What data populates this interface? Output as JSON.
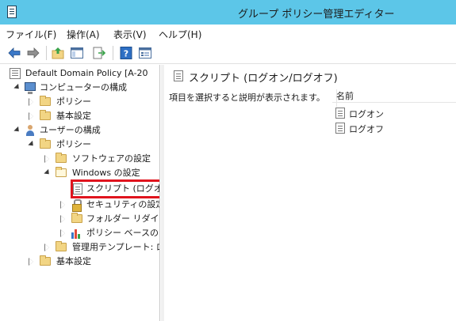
{
  "window": {
    "title": "グループ ポリシー管理エディター"
  },
  "menu": [
    {
      "label": "ファイル(F)"
    },
    {
      "label": "操作(A)"
    },
    {
      "label": "表示(V)"
    },
    {
      "label": "ヘルプ(H)"
    }
  ],
  "toolbar": {
    "buttons": [
      {
        "icon": "back-arrow-icon"
      },
      {
        "icon": "forward-arrow-icon"
      },
      {
        "icon": "up-folder-icon"
      },
      {
        "icon": "show-hide-tree-icon"
      },
      {
        "icon": "export-list-icon"
      },
      {
        "icon": "help-icon"
      },
      {
        "icon": "properties-icon"
      }
    ]
  },
  "tree": {
    "root": "Default Domain Policy [A-20",
    "computer_config": "コンピューターの構成",
    "computer_policy": "ポリシー",
    "computer_basic": "基本設定",
    "user_config": "ユーザーの構成",
    "user_policy": "ポリシー",
    "software_settings": "ソフトウェアの設定",
    "windows_settings": "Windows の設定",
    "scripts": "スクリプト (ログオン/",
    "security_settings": "セキュリティの設定",
    "folder_redirection": "フォルダー リダイレク",
    "policy_qos": "ポリシー ベースの Q",
    "admin_templates": "管理用テンプレート: ロ",
    "user_basic": "基本設定"
  },
  "right_pane": {
    "title": "スクリプト (ログオン/ログオフ)",
    "description": "項目を選択すると説明が表示されます。",
    "column_name": "名前",
    "items": [
      "ログオン",
      "ログオフ"
    ]
  },
  "colors": {
    "titlebar": "#5cc6e8",
    "highlight": "#e0141e"
  }
}
